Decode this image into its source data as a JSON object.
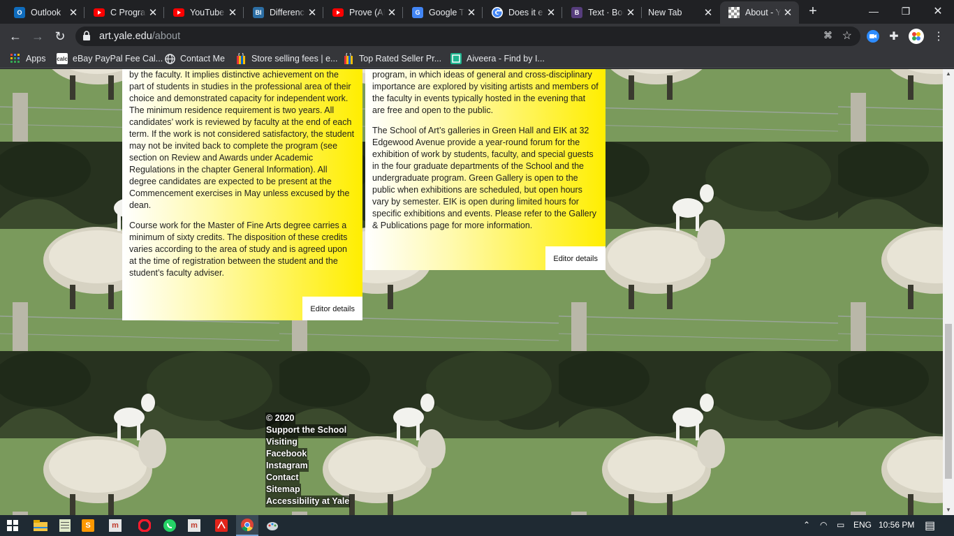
{
  "browser": {
    "tabs": [
      {
        "title": "Outlook",
        "icon": "outlook-icon",
        "color": "#0f6cbd"
      },
      {
        "title": "C Program",
        "icon": "youtube-icon",
        "color": "#ff0000"
      },
      {
        "title": "YouTube",
        "icon": "youtube-icon",
        "color": "#ff0000"
      },
      {
        "title": "Difference",
        "icon": "bi-icon",
        "color": "#2c6ea4"
      },
      {
        "title": "Prove (AI",
        "icon": "youtube-icon",
        "color": "#ff0000"
      },
      {
        "title": "Google Tr",
        "icon": "google-translate-icon",
        "color": "#4285f4"
      },
      {
        "title": "Does it e",
        "icon": "google-icon",
        "color": "#ffffff"
      },
      {
        "title": "Text · Boo",
        "icon": "bootstrap-icon",
        "color": "#563d7c"
      },
      {
        "title": "New Tab",
        "icon": "",
        "color": ""
      },
      {
        "title": "About - Y",
        "icon": "yale-checker-icon",
        "color": "#cccccc"
      }
    ],
    "fav_letters": {
      "outlook": "O",
      "bi": "BI",
      "bootstrap": "B",
      "gt": "G"
    },
    "new_tab_symbol": "+",
    "window_controls": {
      "minimize": "—",
      "restore": "❐",
      "close": "✕"
    },
    "url_host": "art.yale.edu",
    "url_path": "/about",
    "bookmarks": [
      {
        "label": "Apps",
        "icon": "apps-grid-icon"
      },
      {
        "label": "eBay PayPal Fee Cal...",
        "icon": "calculator-icon"
      },
      {
        "label": "Contact Me",
        "icon": "globe-icon"
      },
      {
        "label": "Store selling fees | e...",
        "icon": "ebay-bag-icon"
      },
      {
        "label": "Top Rated Seller Pr...",
        "icon": "ebay-bag-icon"
      },
      {
        "label": "Aiveera - Find by I...",
        "icon": "aiveera-icon"
      }
    ],
    "bm_calc_text": "calc"
  },
  "page": {
    "left_card": {
      "para1": "by the faculty. It implies distinctive achievement on the part of students in studies in the professional area of their choice and demonstrated capacity for independent work. The minimum residence requirement is two years. All candidates’ work is reviewed by faculty at the end of each term. If the work is not considered satisfactory, the student may not be invited back to complete the program (see section on Review and Awards under Academic Regulations in the chapter General Information). All degree candidates are expected to be present at the Commencement exercises in May unless excused by the dean.",
      "para2": "Course work for the Master of Fine Arts degree carries a minimum of sixty credits. The disposition of these credits varies according to the area of study and is agreed upon at the time of registration between the student and the student’s faculty adviser.",
      "editor": "Editor details"
    },
    "right_card": {
      "para1": "program, in which ideas of general and cross-disciplinary importance are explored by visiting artists and members of the faculty in events typically hosted in the evening that are free and open to the public.",
      "para2": "The School of Art’s galleries in Green Hall and EIK at 32 Edgewood Avenue provide a year-round forum for the exhibition of work by students, faculty, and special guests in the four graduate departments of the School and the undergraduate program. Green Gallery is open to the public when exhibitions are scheduled, but open hours vary by semester. EIK is open during limited hours for specific exhibitions and events. Please refer to the Gallery & Publications page for more information.",
      "editor": "Editor details"
    },
    "footer": [
      "© 2020",
      "Support the School",
      "Visiting",
      "Facebook",
      "Instagram",
      "Contact",
      "Sitemap",
      "Accessibility at Yale"
    ],
    "background": "sheep-with-goat-on-back tiled image"
  },
  "taskbar": {
    "language": "ENG",
    "time": "10:56 PM",
    "apps": [
      "windows-start-icon",
      "file-explorer-icon",
      "notepad-icon",
      "sublime-icon",
      "app-icon",
      "opera-icon",
      "whatsapp-icon",
      "app-icon",
      "acrobat-icon",
      "chrome-icon",
      "paint-icon"
    ]
  }
}
